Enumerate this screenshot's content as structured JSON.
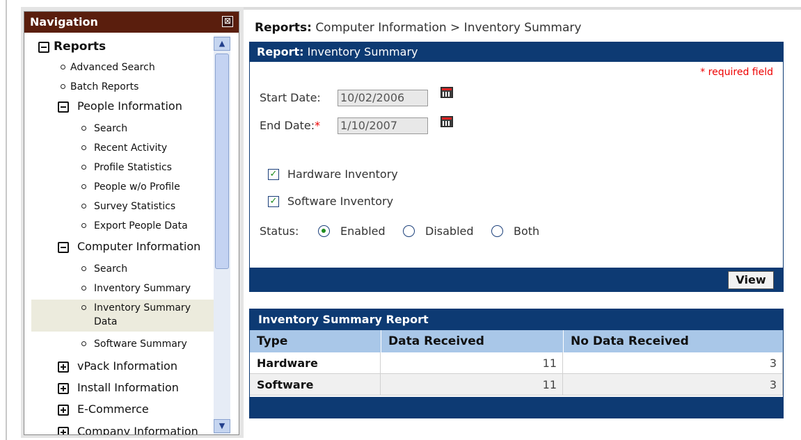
{
  "nav": {
    "title": "Navigation",
    "close_glyph": "⊠",
    "items": [
      {
        "label": "Reports"
      },
      {
        "label": "Advanced Search"
      },
      {
        "label": "Batch Reports"
      },
      {
        "label": "People Information"
      },
      {
        "label": "Search"
      },
      {
        "label": "Recent Activity"
      },
      {
        "label": "Profile Statistics"
      },
      {
        "label": "People w/o Profile"
      },
      {
        "label": "Survey Statistics"
      },
      {
        "label": "Export People Data"
      },
      {
        "label": "Computer Information"
      },
      {
        "label": "Search"
      },
      {
        "label": "Inventory Summary"
      },
      {
        "label": "Inventory Summary",
        "label2": "Data"
      },
      {
        "label": "Software Summary"
      },
      {
        "label": "vPack Information"
      },
      {
        "label": "Install Information"
      },
      {
        "label": "E-Commerce"
      },
      {
        "label": "Company Information"
      }
    ]
  },
  "breadcrumb": {
    "prefix": "Reports:",
    "path": "Computer Information > Inventory Summary"
  },
  "form": {
    "header_prefix": "Report:",
    "header_title": "Inventory Summary",
    "required_note": "* required field",
    "start_label": "Start Date:",
    "start_value": "10/02/2006",
    "end_label": "End Date:",
    "end_star": "*",
    "end_value": "1/10/2007",
    "hardware_label": "Hardware Inventory",
    "hardware_checked": true,
    "software_label": "Software Inventory",
    "software_checked": true,
    "status_label": "Status:",
    "status_options": [
      "Enabled",
      "Disabled",
      "Both"
    ],
    "status_selected": "Enabled",
    "view_label": "View",
    "check_glyph": "✓"
  },
  "report": {
    "title": "Inventory Summary Report",
    "columns": [
      "Type",
      "Data Received",
      "No Data Received"
    ],
    "rows": [
      {
        "type": "Hardware",
        "received": "11",
        "none": "3"
      },
      {
        "type": "Software",
        "received": "11",
        "none": "3"
      }
    ]
  }
}
